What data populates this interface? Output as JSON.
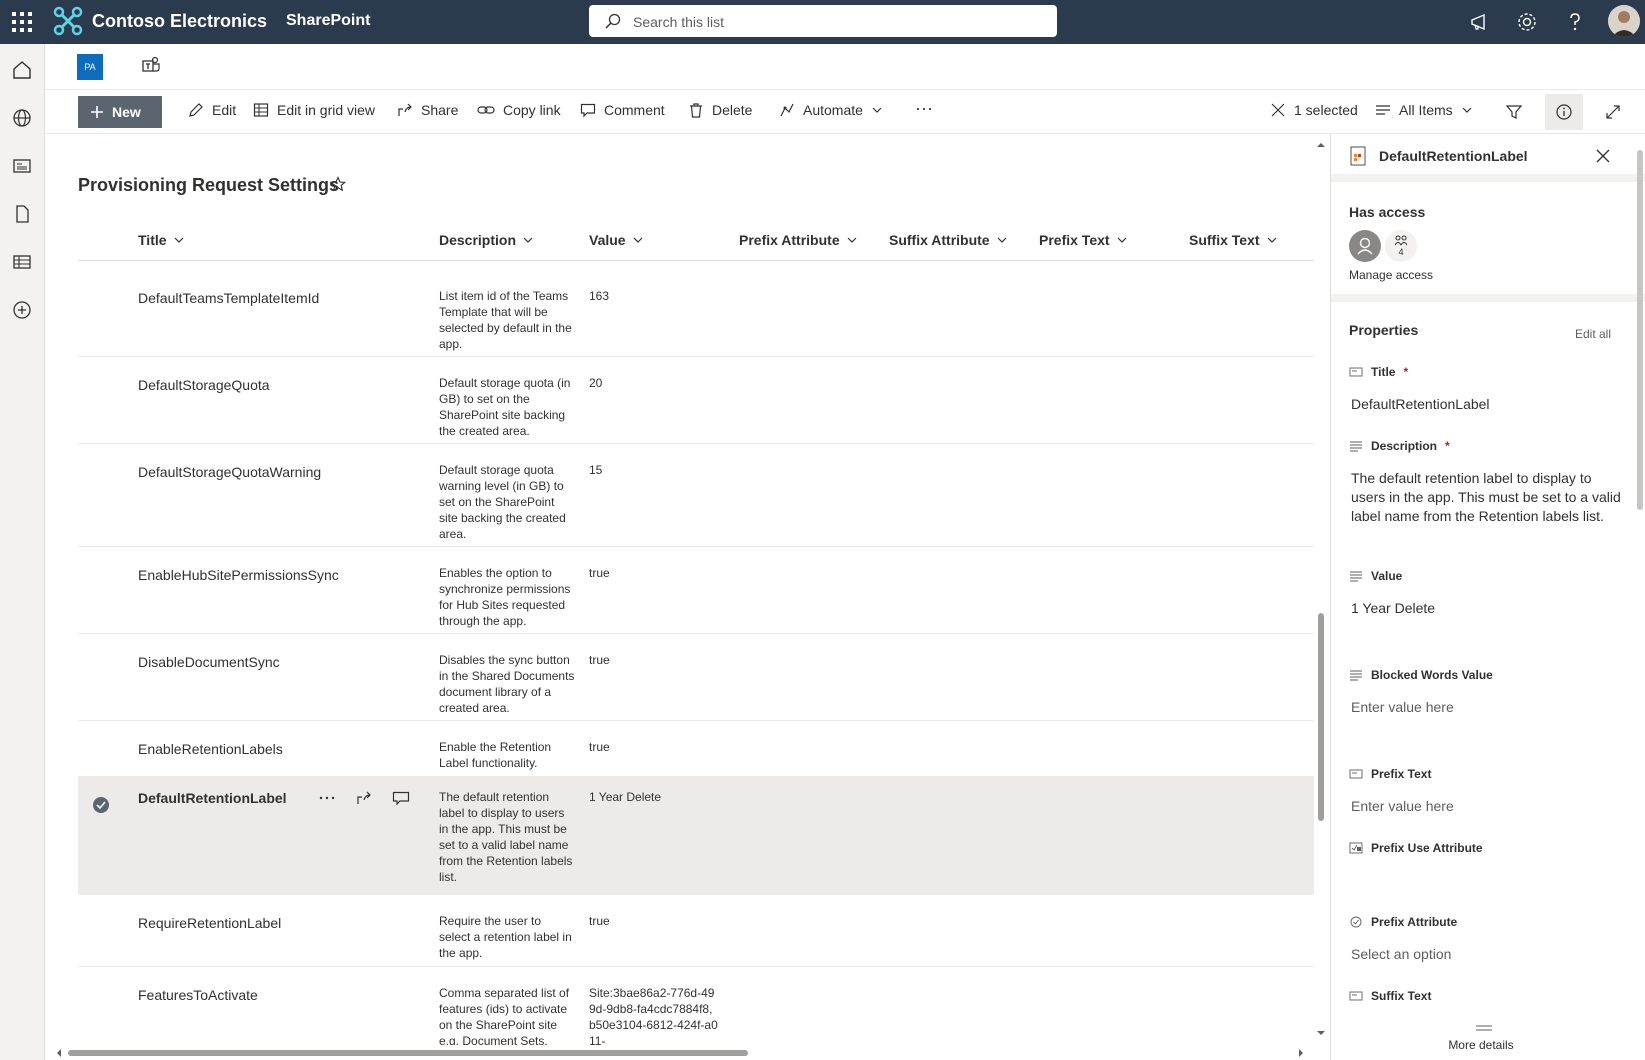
{
  "suite": {
    "brand": "Contoso Electronics",
    "app": "SharePoint",
    "search_placeholder": "Search this list",
    "icons": [
      "waffle-icon",
      "megaphone-icon",
      "gear-icon",
      "help-icon"
    ]
  },
  "site": {
    "logo_text": "PA"
  },
  "commands": {
    "new": "New",
    "edit": "Edit",
    "edit_grid": "Edit in grid view",
    "share": "Share",
    "copy_link": "Copy link",
    "comment": "Comment",
    "delete": "Delete",
    "automate": "Automate",
    "more": "···",
    "selected": "1 selected",
    "view": "All Items"
  },
  "list": {
    "title": "Provisioning Request Settings",
    "columns": [
      "Title",
      "Description",
      "Value",
      "Prefix Attribute",
      "Suffix Attribute",
      "Prefix Text",
      "Suffix Text"
    ],
    "rows": [
      {
        "title": "DefaultTeamsTemplateItemId",
        "description": "List item id of the Teams Template that will be selected by default in the app.",
        "value": "163"
      },
      {
        "title": "DefaultStorageQuota",
        "description": "Default storage quota (in GB) to set on the SharePoint site backing the created area.",
        "value": "20"
      },
      {
        "title": "DefaultStorageQuotaWarning",
        "description": "Default storage quota warning level (in GB) to set on the SharePoint site backing the created area.",
        "value": "15"
      },
      {
        "title": "EnableHubSitePermissionsSync",
        "description": "Enables the option to synchronize permissions for Hub Sites requested through the app.",
        "value": "true"
      },
      {
        "title": "DisableDocumentSync",
        "description": "Disables the sync button in the Shared Documents document library of a created area.",
        "value": "true"
      },
      {
        "title": "EnableRetentionLabels",
        "description": "Enable the Retention Label functionality.",
        "value": "true"
      },
      {
        "title": "DefaultRetentionLabel",
        "description": "The default retention label to display to users in the app. This must be set to a valid label name from the Retention labels list.",
        "value": "1 Year Delete",
        "selected": true
      },
      {
        "title": "RequireRetentionLabel",
        "description": "Require the user to select a retention label in the app.",
        "value": "true"
      },
      {
        "title": "FeaturesToActivate",
        "description": "Comma separated list of features (ids) to activate on the SharePoint site e.g. Document Sets.",
        "value": "Site:3bae86a2-776d-499d-9db8-fa4cdc7884f8,b50e3104-6812-424f-a011-"
      }
    ]
  },
  "panel": {
    "item_title": "DefaultRetentionLabel",
    "has_access": "Has access",
    "access_count": "4",
    "manage_access": "Manage access",
    "properties": "Properties",
    "edit_all": "Edit all",
    "required_mark": "*",
    "fields": {
      "title": {
        "label": "Title",
        "value": "DefaultRetentionLabel"
      },
      "description": {
        "label": "Description",
        "value": "The default retention label to display to users in the app. This must be set to a valid label name from the Retention labels list."
      },
      "value": {
        "label": "Value",
        "value": "1 Year Delete"
      },
      "blocked_words": {
        "label": "Blocked Words Value",
        "value": "Enter value here"
      },
      "prefix_text": {
        "label": "Prefix Text",
        "value": "Enter value here"
      },
      "prefix_use_attr": {
        "label": "Prefix Use Attribute"
      },
      "prefix_attr": {
        "label": "Prefix Attribute",
        "value": "Select an option"
      },
      "suffix_text": {
        "label": "Suffix Text"
      }
    },
    "more_details": "More details"
  }
}
